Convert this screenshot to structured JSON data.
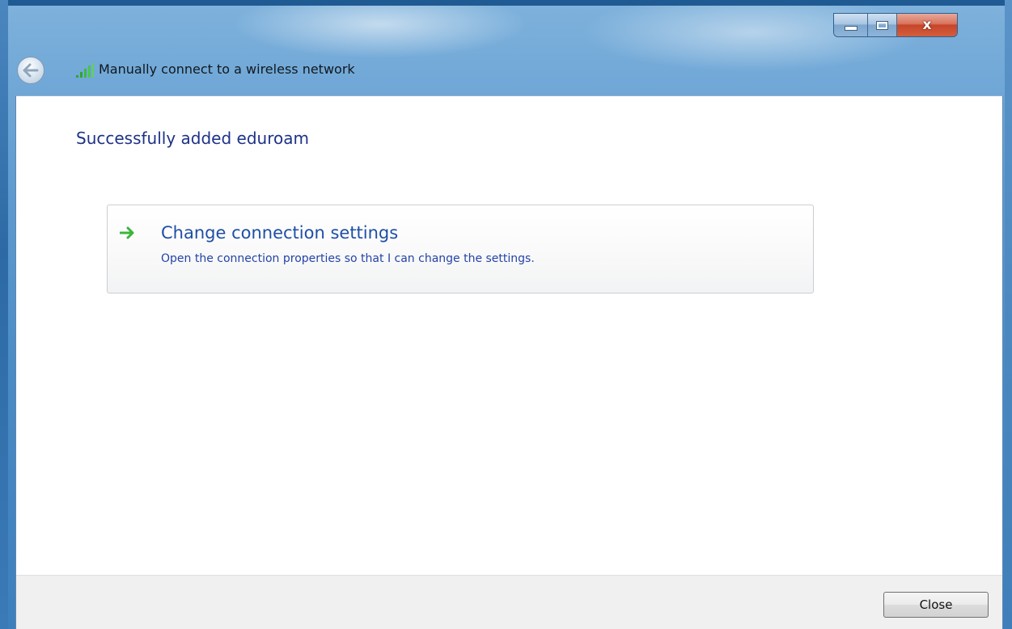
{
  "window": {
    "title": "Manually connect to a wireless network",
    "caption_buttons": {
      "minimize_icon": "minimize-icon",
      "maximize_icon": "maximize-icon",
      "close_glyph": "x"
    },
    "back_icon": "back-arrow-icon",
    "title_icon": "wireless-signal-icon"
  },
  "content": {
    "heading": "Successfully added eduroam",
    "option": {
      "icon": "green-arrow-icon",
      "title": "Change connection settings",
      "description": "Open the connection properties so that I can change the settings."
    }
  },
  "footer": {
    "close_label": "Close"
  },
  "colors": {
    "heading": "#1e3287",
    "link": "#1e4fa6",
    "arrow": "#3cb43c",
    "frame": "#4a8bc5",
    "close_button": "#c7452a"
  }
}
